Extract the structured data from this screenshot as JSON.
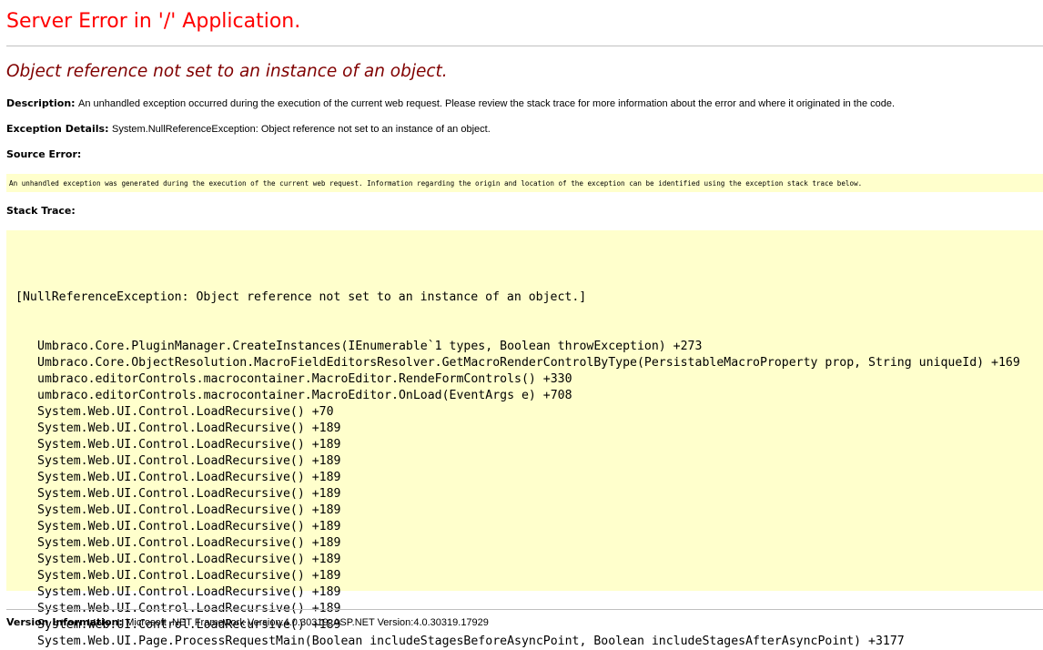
{
  "title": "Server Error in '/' Application.",
  "subtitle": "Object reference not set to an instance of an object.",
  "description": {
    "label": "Description:",
    "text": "An unhandled exception occurred during the execution of the current web request. Please review the stack trace for more information about the error and where it originated in the code."
  },
  "exception_details": {
    "label": "Exception Details:",
    "text": "System.NullReferenceException: Object reference not set to an instance of an object."
  },
  "source_error": {
    "label": "Source Error:",
    "text": "An unhandled exception was generated during the execution of the current web request. Information regarding the origin and location of the exception can be identified using the exception stack trace below."
  },
  "stack_trace": {
    "label": "Stack Trace:",
    "header": "[NullReferenceException: Object reference not set to an instance of an object.]",
    "lines": [
      "Umbraco.Core.PluginManager.CreateInstances(IEnumerable`1 types, Boolean throwException) +273",
      "Umbraco.Core.ObjectResolution.MacroFieldEditorsResolver.GetMacroRenderControlByType(PersistableMacroProperty prop, String uniqueId) +169",
      "umbraco.editorControls.macrocontainer.MacroEditor.RendeFormControls() +330",
      "umbraco.editorControls.macrocontainer.MacroEditor.OnLoad(EventArgs e) +708",
      "System.Web.UI.Control.LoadRecursive() +70",
      "System.Web.UI.Control.LoadRecursive() +189",
      "System.Web.UI.Control.LoadRecursive() +189",
      "System.Web.UI.Control.LoadRecursive() +189",
      "System.Web.UI.Control.LoadRecursive() +189",
      "System.Web.UI.Control.LoadRecursive() +189",
      "System.Web.UI.Control.LoadRecursive() +189",
      "System.Web.UI.Control.LoadRecursive() +189",
      "System.Web.UI.Control.LoadRecursive() +189",
      "System.Web.UI.Control.LoadRecursive() +189",
      "System.Web.UI.Control.LoadRecursive() +189",
      "System.Web.UI.Control.LoadRecursive() +189",
      "System.Web.UI.Control.LoadRecursive() +189",
      "System.Web.UI.Control.LoadRecursive() +189",
      "System.Web.UI.Page.ProcessRequestMain(Boolean includeStagesBeforeAsyncPoint, Boolean includeStagesAfterAsyncPoint) +3177"
    ]
  },
  "version": {
    "label": "Version Information:",
    "text": "Microsoft .NET Framework Version:4.0.30319; ASP.NET Version:4.0.30319.17929"
  },
  "colors": {
    "title": "#ff0000",
    "subtitle": "#800000",
    "code_background": "#ffffcc"
  }
}
